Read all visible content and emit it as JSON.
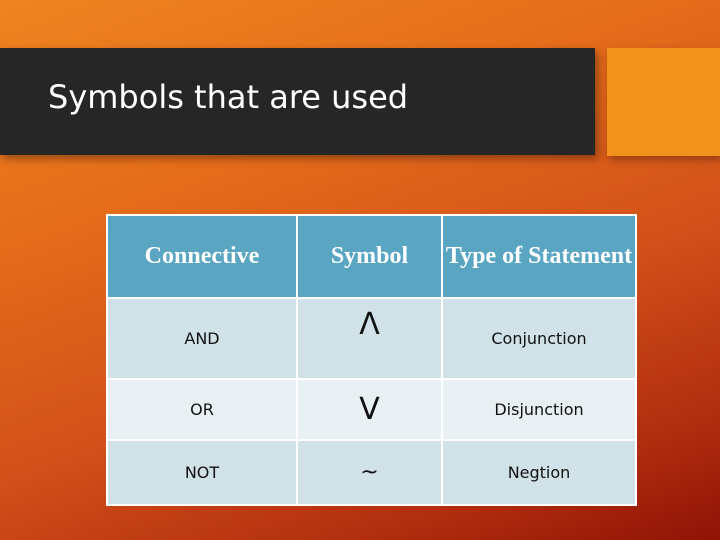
{
  "slide": {
    "title": "Symbols that are used",
    "colors": {
      "title_bar": "#262626",
      "accent_box": "#f0921c",
      "header_fill": "#5aa5c2",
      "row_fill_dark": "#d0e1e8",
      "row_fill_light": "#e8f0f3",
      "background_start": "#ee8420",
      "background_end": "#8f1206"
    }
  },
  "table": {
    "headers": [
      "Connective",
      "Symbol",
      "Type of Statement"
    ],
    "rows": [
      {
        "connective": "AND",
        "symbol": "Λ",
        "type": "Conjunction"
      },
      {
        "connective": "OR",
        "symbol": "V",
        "type": "Disjunction"
      },
      {
        "connective": "NOT",
        "symbol": "~",
        "type": "Negtion"
      }
    ]
  }
}
